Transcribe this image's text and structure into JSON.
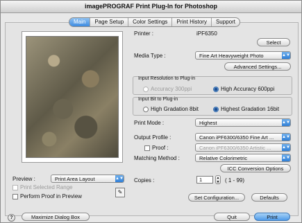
{
  "window": {
    "title": "imagePROGRAF Print Plug-In for Photoshop"
  },
  "tabs": [
    "Main",
    "Page Setup",
    "Color Settings",
    "Print History",
    "Support"
  ],
  "printer": {
    "label": "Printer :",
    "value": "iPF6350",
    "select_button": "Select"
  },
  "media": {
    "label": "Media Type :",
    "value": "Fine Art Heavyweight Photo",
    "advanced_button": "Advanced Settings..."
  },
  "input_resolution": {
    "title": "Input Resolution to Plug-in",
    "option_standard": "Accuracy 300ppi",
    "option_high": "High Accuracy 600ppi",
    "selected": "High Accuracy 600ppi"
  },
  "input_bit": {
    "title": "Input Bit to Plug-in",
    "option_8": "High Gradation 8bit",
    "option_16": "Highest Gradation 16bit",
    "selected": "Highest Gradation 16bit"
  },
  "print_mode": {
    "label": "Print Mode :",
    "value": "Highest"
  },
  "output_profile": {
    "label": "Output Profile :",
    "value": "Canon iPF6300/6350 Fine Art ..."
  },
  "proof": {
    "label": "Proof :",
    "value": "Canon iPF6300/6350 Artistic ..."
  },
  "matching": {
    "label": "Matching Method :",
    "value": "Relative Colorimetric",
    "icc_button": "ICC Conversion Options"
  },
  "copies": {
    "label": "Copies :",
    "value": "1",
    "range": "( 1 - 99)"
  },
  "preview": {
    "label": "Preview :",
    "value": "Print Area Layout"
  },
  "checkboxes": {
    "print_selected": "Print Selected Range",
    "perform_proof": "Perform Proof in Preview"
  },
  "buttons": {
    "set_configuration": "Set Configuration...",
    "defaults": "Defaults",
    "maximize": "Maximize Dialog Box",
    "quit": "Quit",
    "print": "Print"
  },
  "icons": {
    "help": "?",
    "arrow": "▲▼",
    "proof_tool": "✎"
  },
  "colors": {
    "accent": "#3d8be0"
  }
}
